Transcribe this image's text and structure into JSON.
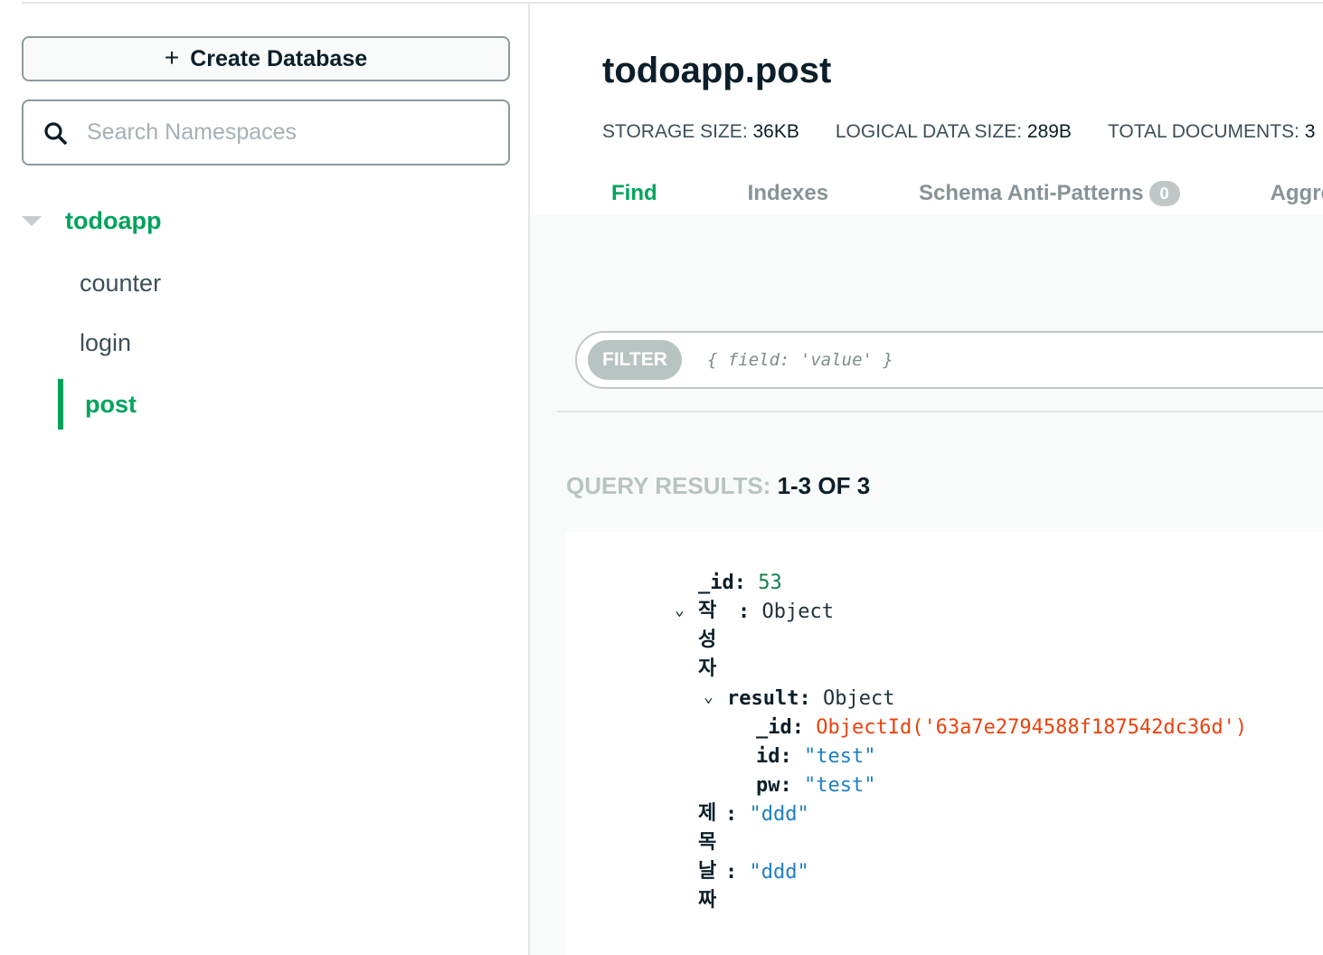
{
  "sidebar": {
    "create_database_label": "Create Database",
    "search_placeholder": "Search Namespaces",
    "database": "todoapp",
    "collections": [
      "counter",
      "login"
    ],
    "active_collection": "post"
  },
  "main": {
    "title": "todoapp.post",
    "stats": {
      "storage_size_label": "STORAGE SIZE:",
      "storage_size": "36KB",
      "logical_size_label": "LOGICAL DATA SIZE:",
      "logical_size": "289B",
      "total_docs_label": "TOTAL DOCUMENTS:",
      "total_docs": "3"
    },
    "tabs": [
      "Find",
      "Indexes",
      "Schema Anti-Patterns",
      "Aggregations"
    ],
    "anti_patterns_count": "0",
    "filter_label": "FILTER",
    "filter_placeholder": "{ field: 'value' }",
    "results_label": "QUERY RESULTS:",
    "results_count": "1-3 OF 3"
  },
  "document": {
    "id_key": "_id:",
    "id_value": "53",
    "writer_key": "작성자",
    "writer_type": "Object",
    "result_key": "result:",
    "result_type": "Object",
    "result_id_key": "_id:",
    "result_id_value": "ObjectId('63a7e2794588f187542dc36d')",
    "result_userid_key": "id:",
    "result_userid_value": "\"test\"",
    "result_pw_key": "pw:",
    "result_pw_value": "\"test\"",
    "title_key": "제목",
    "title_value": "\"ddd\"",
    "date_key": "날짜",
    "date_value": "\"ddd\""
  },
  "colors": {
    "accent_green": "#00a35c",
    "objectid_orange": "#e8430d",
    "string_blue": "#1e7fc2"
  }
}
